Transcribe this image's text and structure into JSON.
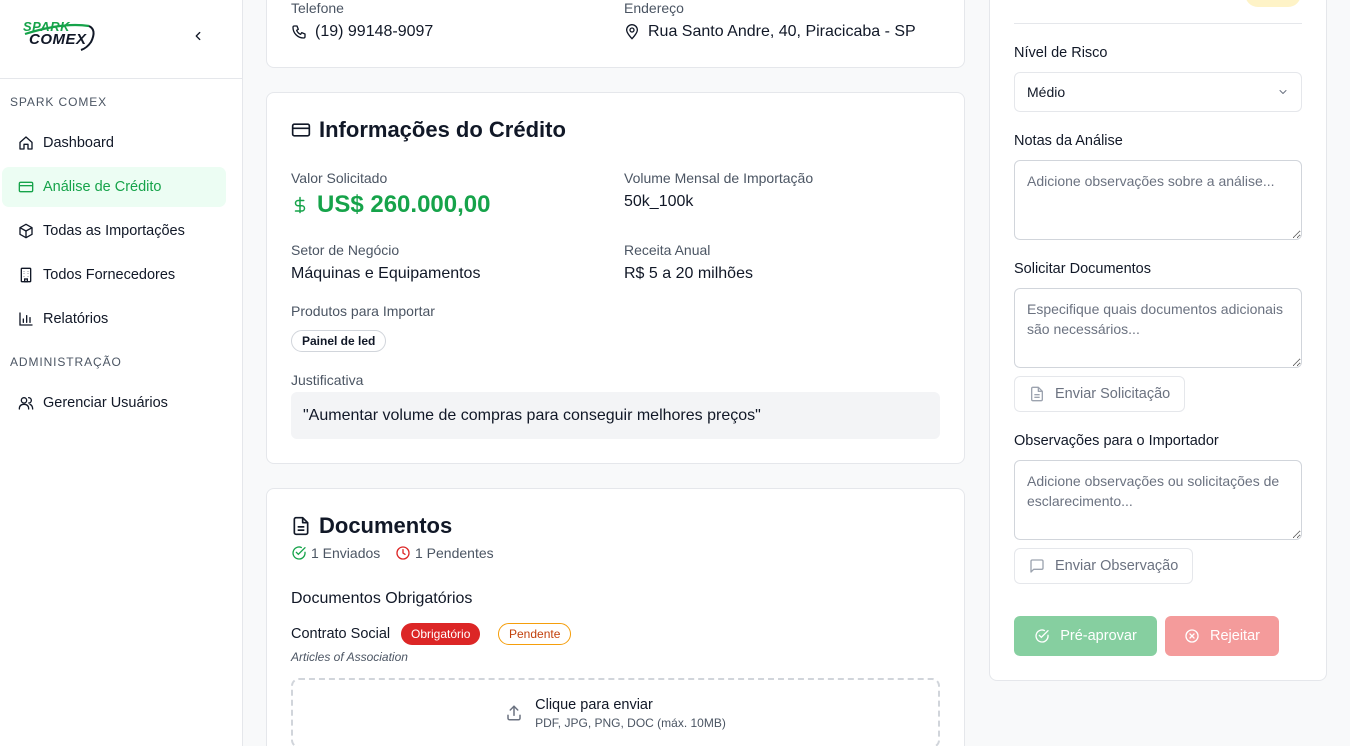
{
  "brand": {
    "line1": "SPARK",
    "line2": "COMEX"
  },
  "sidebar": {
    "section1": "SPARK COMEX",
    "section2": "ADMINISTRAÇÃO",
    "items": [
      {
        "label": "Dashboard",
        "icon": "home-icon"
      },
      {
        "label": "Análise de Crédito",
        "icon": "credit-card-icon",
        "active": true
      },
      {
        "label": "Todas as Importações",
        "icon": "package-icon"
      },
      {
        "label": "Todos Fornecedores",
        "icon": "building-icon"
      },
      {
        "label": "Relatórios",
        "icon": "bar-chart-icon"
      },
      {
        "label": "Gerenciar Usuários",
        "icon": "users-icon"
      }
    ]
  },
  "contact": {
    "phone_label": "Telefone",
    "phone_value": "(19) 99148-9097",
    "address_label": "Endereço",
    "address_value": "Rua Santo Andre, 40, Piracicaba - SP"
  },
  "credit": {
    "title": "Informações do Crédito",
    "requested_label": "Valor Solicitado",
    "requested_value": "US$ 260.000,00",
    "volume_label": "Volume Mensal de Importação",
    "volume_value": "50k_100k",
    "sector_label": "Setor de Negócio",
    "sector_value": "Máquinas e Equipamentos",
    "revenue_label": "Receita Anual",
    "revenue_value": "R$ 5 a 20 milhões",
    "products_label": "Produtos para Importar",
    "products": [
      "Painel de led"
    ],
    "justification_label": "Justificativa",
    "justification_value": "\"Aumentar volume de compras para conseguir melhores preços\""
  },
  "documents": {
    "title": "Documentos",
    "sent": "1 Enviados",
    "pending": "1 Pendentes",
    "required_title": "Documentos Obrigatórios",
    "item_name": "Contrato Social",
    "item_badge_required": "Obrigatório",
    "item_badge_status": "Pendente",
    "item_subtitle": "Articles of Association",
    "upload_title": "Clique para enviar",
    "upload_hint": "PDF, JPG, PNG, DOC (máx. 10MB)"
  },
  "analysis": {
    "risk_label": "Nível de Risco",
    "risk_value": "Médio",
    "notes_label": "Notas da Análise",
    "notes_placeholder": "Adicione observações sobre a análise...",
    "request_docs_label": "Solicitar Documentos",
    "request_docs_placeholder": "Especifique quais documentos adicionais são necessários...",
    "send_request_button": "Enviar Solicitação",
    "importer_obs_label": "Observações para o Importador",
    "importer_obs_placeholder": "Adicione observações ou solicitações de esclarecimento...",
    "send_obs_button": "Enviar Observação",
    "preapprove_button": "Pré-aprovar",
    "reject_button": "Rejeitar"
  },
  "colors": {
    "accent": "#16a34a",
    "preapprove_bg": "#86cfa0",
    "reject_bg": "#f49b9b",
    "risk_badge_bg": "#fef3c7"
  }
}
